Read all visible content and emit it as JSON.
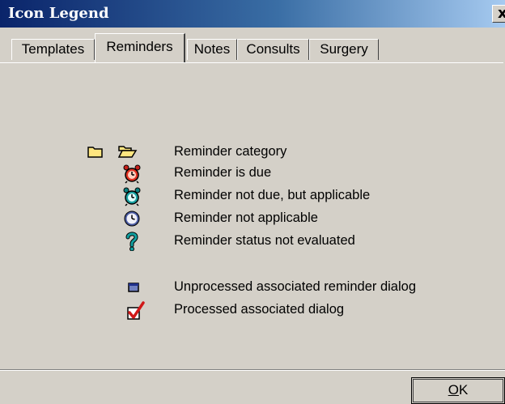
{
  "window": {
    "title": "Icon Legend",
    "close_label": "x"
  },
  "tabs": [
    {
      "label": "Templates"
    },
    {
      "label": "Reminders"
    },
    {
      "label": "Notes"
    },
    {
      "label": "Consults"
    },
    {
      "label": "Surgery"
    }
  ],
  "active_tab": "Reminders",
  "legend": {
    "items": [
      {
        "icon": "folder-icon",
        "icon2": "folder-open-icon",
        "label": "Reminder category"
      },
      {
        "icon": "red-alarm-clock-icon",
        "label": "Reminder is due"
      },
      {
        "icon": "teal-alarm-clock-icon",
        "label": "Reminder not due, but applicable"
      },
      {
        "icon": "clock-icon",
        "label": "Reminder not applicable"
      },
      {
        "icon": "question-mark-icon",
        "label": "Reminder status not evaluated"
      },
      {
        "icon": "dialog-box-icon",
        "label": "Unprocessed associated reminder dialog"
      },
      {
        "icon": "red-checkmark-icon",
        "label": "Processed associated dialog"
      }
    ]
  },
  "buttons": {
    "ok_mnemonic": "O",
    "ok_rest": "K"
  },
  "colors": {
    "titlebar_start": "#0a246a",
    "titlebar_end": "#a6caf0",
    "window_bg": "#d4d0c8"
  }
}
